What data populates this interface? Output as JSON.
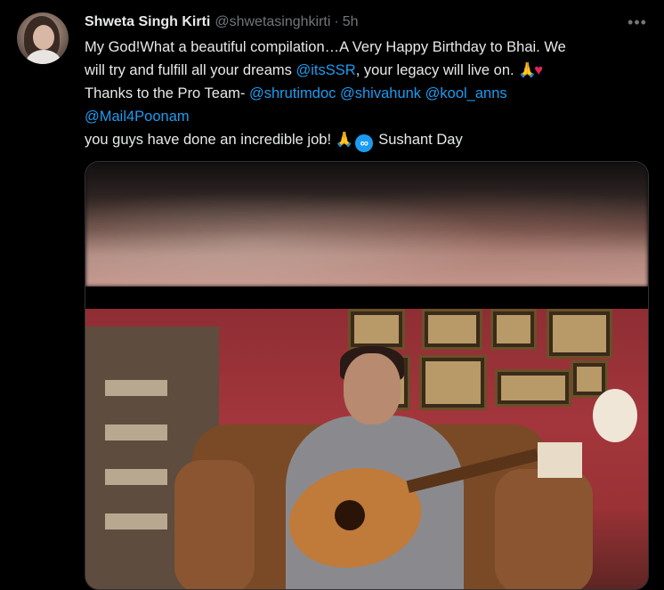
{
  "tweet": {
    "author_name": "Shweta Singh Kirti",
    "author_handle": "@shwetasinghkirti",
    "separator": "·",
    "time": "5h",
    "more_glyph": "•••",
    "lines": {
      "l1": "My God!What a beautiful compilation…A Very Happy Birthday to Bhai. We",
      "l2_pre": "will try and fulfill all your dreams ",
      "l2_mention": "@itsSSR",
      "l2_post": ", your legacy will live on. ",
      "l2_emoji_hands": "🙏",
      "l2_emoji_heart": "♥",
      "l3_pre": "Thanks to the Pro Team-  ",
      "l3_mention1": "@shrutimdoc",
      "l3_mention2": "@shivahunk",
      "l3_mention3": "@kool_anns",
      "l4_mention": "@Mail4Poonam",
      "l5_pre": "you guys have done an incredible job! ",
      "l5_emoji_hands": "🙏",
      "l5_infinity": "∞",
      "l5_post": "Sushant Day"
    }
  },
  "icons": {
    "more": "more-horizontal-icon",
    "infinity": "infinity-badge-icon"
  },
  "colors": {
    "background": "#000000",
    "text": "#e7e9ea",
    "secondary": "#71767b",
    "link": "#1d9bf0",
    "heart": "#e0245e"
  }
}
